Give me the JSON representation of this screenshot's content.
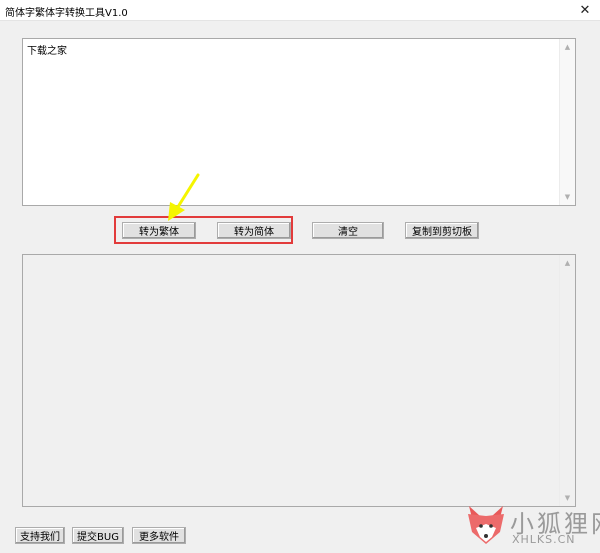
{
  "window": {
    "title": "简体字繁体字转换工具V1.0",
    "close_glyph": "✕"
  },
  "input": {
    "value": "下载之家"
  },
  "output": {
    "value": ""
  },
  "buttons": {
    "to_traditional": "转为繁体",
    "to_simplified": "转为简体",
    "clear": "清空",
    "copy_to_clipboard": "复制到剪切板",
    "support_us": "支持我们",
    "submit_bug": "提交BUG",
    "more_software": "更多软件"
  },
  "annotations": {
    "highlight_color": "#e23b3b",
    "arrow_color": "#f5f500"
  },
  "watermark": {
    "chinese": "小狐狸网",
    "english": "XHLKS.CN",
    "logo": "fox-logo"
  },
  "icons": {
    "scroll_up": "▲",
    "scroll_down": "▼"
  }
}
